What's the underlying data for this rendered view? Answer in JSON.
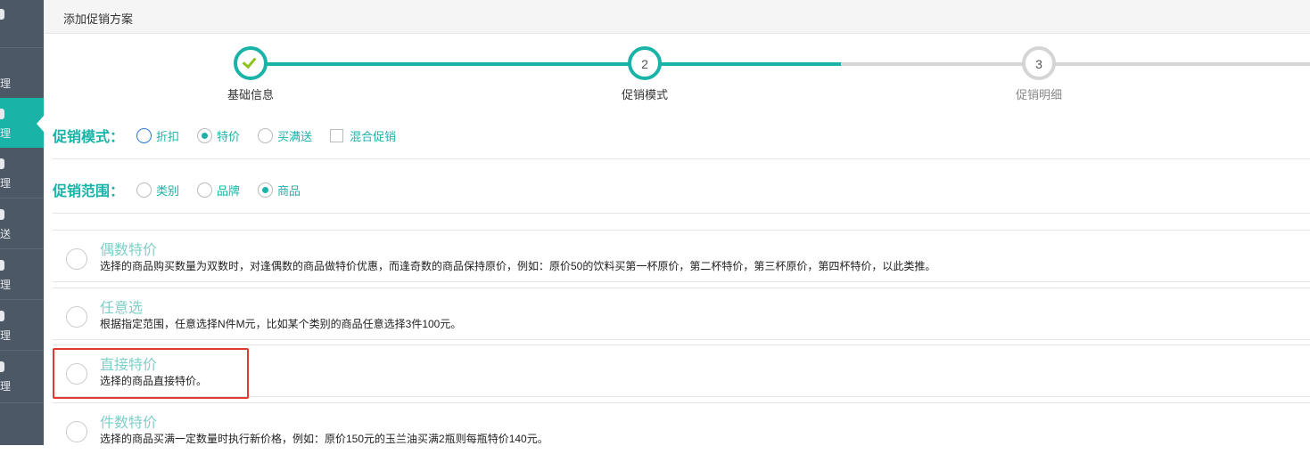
{
  "header": {
    "title": "添加促销方案"
  },
  "sidebar": {
    "items": [
      {
        "label": "",
        "partial": "理"
      },
      {
        "label": "理"
      },
      {
        "label": "理"
      },
      {
        "label": "理"
      },
      {
        "label": "送"
      },
      {
        "label": "理"
      },
      {
        "label": "理"
      },
      {
        "label": "理"
      }
    ]
  },
  "steps": [
    {
      "number": "",
      "label": "基础信息",
      "status": "done"
    },
    {
      "number": "2",
      "label": "促销模式",
      "status": "active"
    },
    {
      "number": "3",
      "label": "促销明细",
      "status": "todo"
    }
  ],
  "promo_mode": {
    "title": "促销模式：",
    "options": [
      {
        "label": "折扣",
        "selected": false
      },
      {
        "label": "特价",
        "selected": true
      },
      {
        "label": "买满送",
        "selected": false
      },
      {
        "label": "混合促销",
        "checkbox": true,
        "checked": false
      }
    ]
  },
  "promo_scope": {
    "title": "促销范围：",
    "options": [
      {
        "label": "类别",
        "selected": false
      },
      {
        "label": "品牌",
        "selected": false
      },
      {
        "label": "商品",
        "selected": true
      }
    ]
  },
  "modes": [
    {
      "title": "偶数特价",
      "desc": "选择的商品购买数量为双数时，对逢偶数的商品做特价优惠，而逢奇数的商品保持原价，例如：原价50的饮料买第一杯原价，第二杯特价，第三杯原价，第四杯特价，以此类推。"
    },
    {
      "title": "任意选",
      "desc": "根据指定范围，任意选择N件M元，比如某个类别的商品任意选择3件100元。"
    },
    {
      "title": "直接特价",
      "desc": "选择的商品直接特价。"
    },
    {
      "title": "件数特价",
      "desc": "选择的商品买满一定数量时执行新价格，例如：原价150元的玉兰油买满2瓶则每瓶特价140元。"
    }
  ],
  "colors": {
    "accent": "#1ab3a8",
    "sidebar": "#4d5866",
    "highlight": "#e03a30"
  }
}
